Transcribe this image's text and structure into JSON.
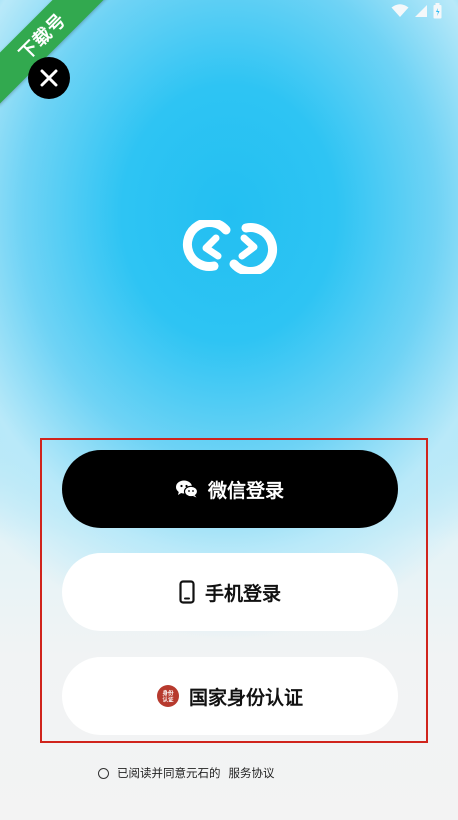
{
  "watermark": {
    "text": "下载号"
  },
  "status_bar": {
    "icons": [
      "wifi-icon",
      "signal-icon",
      "battery-icon"
    ]
  },
  "close_button": {
    "icon": "close-icon"
  },
  "logo": {
    "icon": "app-logo-link-icon"
  },
  "login_buttons": {
    "wechat": {
      "label": "微信登录",
      "icon": "wechat-icon"
    },
    "phone": {
      "label": "手机登录",
      "icon": "phone-icon"
    },
    "national_id": {
      "label": "国家身份认证",
      "icon": "id-auth-badge-icon",
      "badge_text": "身份认证"
    }
  },
  "agreement": {
    "prefix": "已阅读并同意元石的",
    "link": "服务协议"
  },
  "colors": {
    "highlight_border": "#d0241c",
    "watermark_green": "#32a94f",
    "id_badge_red": "#b73a2e"
  }
}
